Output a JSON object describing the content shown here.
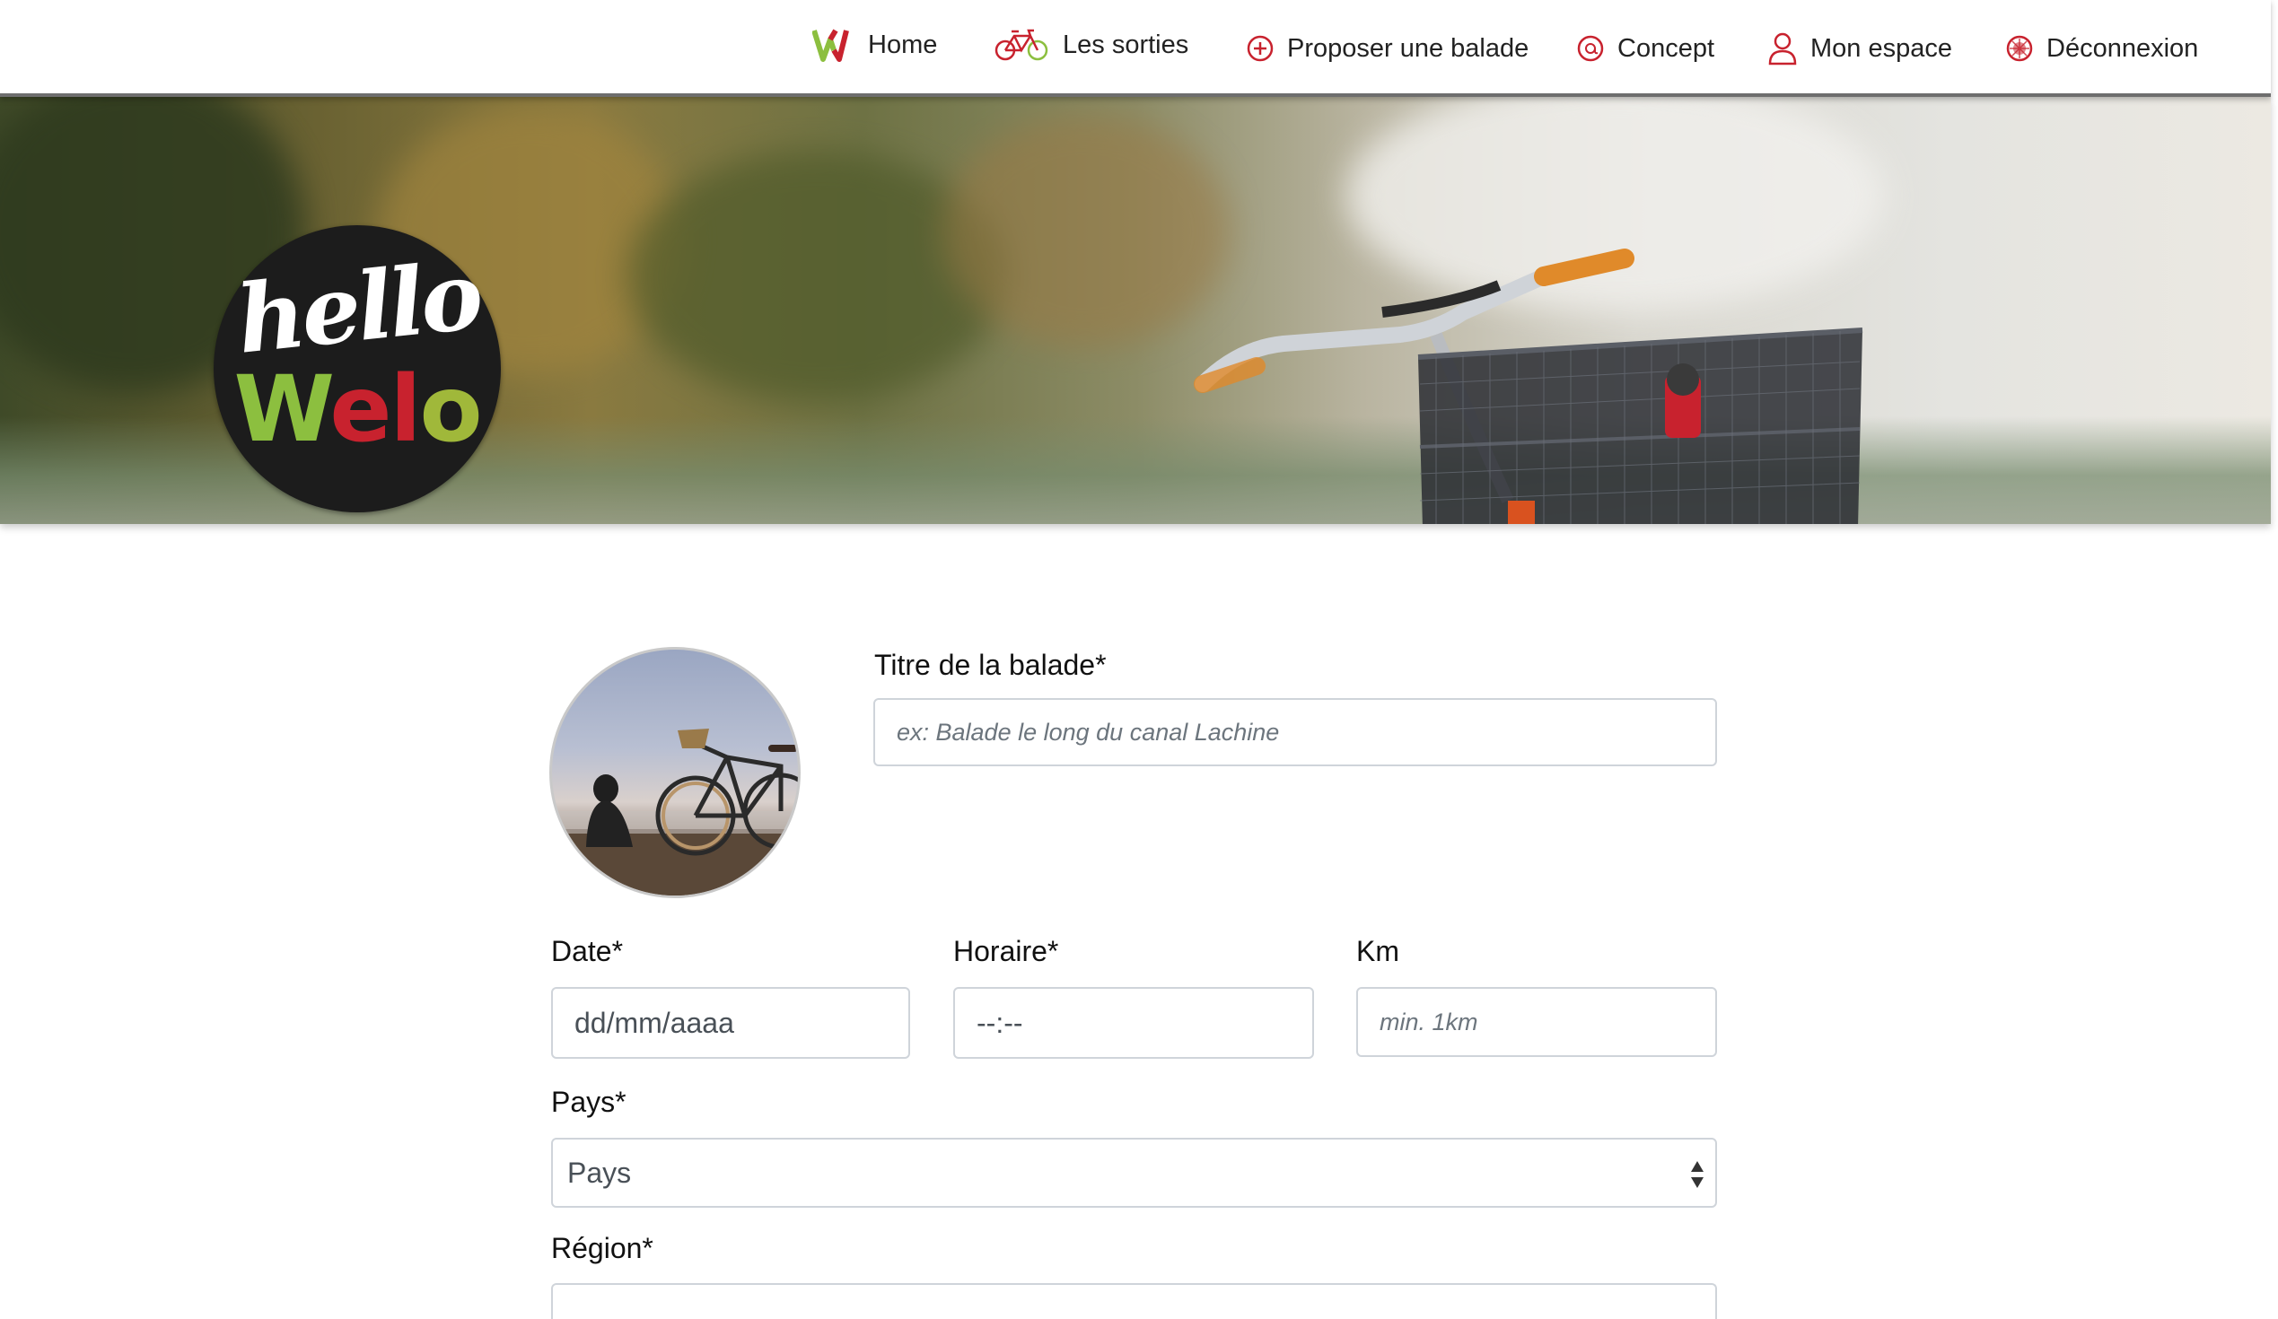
{
  "nav": {
    "items": [
      {
        "label": "Home",
        "icon": "welo-w-icon"
      },
      {
        "label": "Les sorties",
        "icon": "bicycle-icon"
      },
      {
        "label": "Proposer une balade",
        "icon": "plus-circle-icon"
      },
      {
        "label": "Concept",
        "icon": "at-circle-icon"
      },
      {
        "label": "Mon espace",
        "icon": "user-icon"
      },
      {
        "label": "Déconnexion",
        "icon": "power-icon"
      }
    ]
  },
  "logo": {
    "line1": "hello",
    "line2": "Welo"
  },
  "colors": {
    "brand_red": "#c8222e",
    "brand_green": "#8cbf3f",
    "logo_bg": "#1c1c1c"
  },
  "form": {
    "title": {
      "label": "Titre de la balade*",
      "placeholder": "ex: Balade le long du canal Lachine"
    },
    "date": {
      "label": "Date*",
      "value": "dd/mm/aaaa"
    },
    "horaire": {
      "label": "Horaire*",
      "value": "--:--"
    },
    "km": {
      "label": "Km",
      "placeholder": "min. 1km"
    },
    "pays": {
      "label": "Pays*",
      "selected": "Pays"
    },
    "region": {
      "label": "Région*"
    }
  }
}
